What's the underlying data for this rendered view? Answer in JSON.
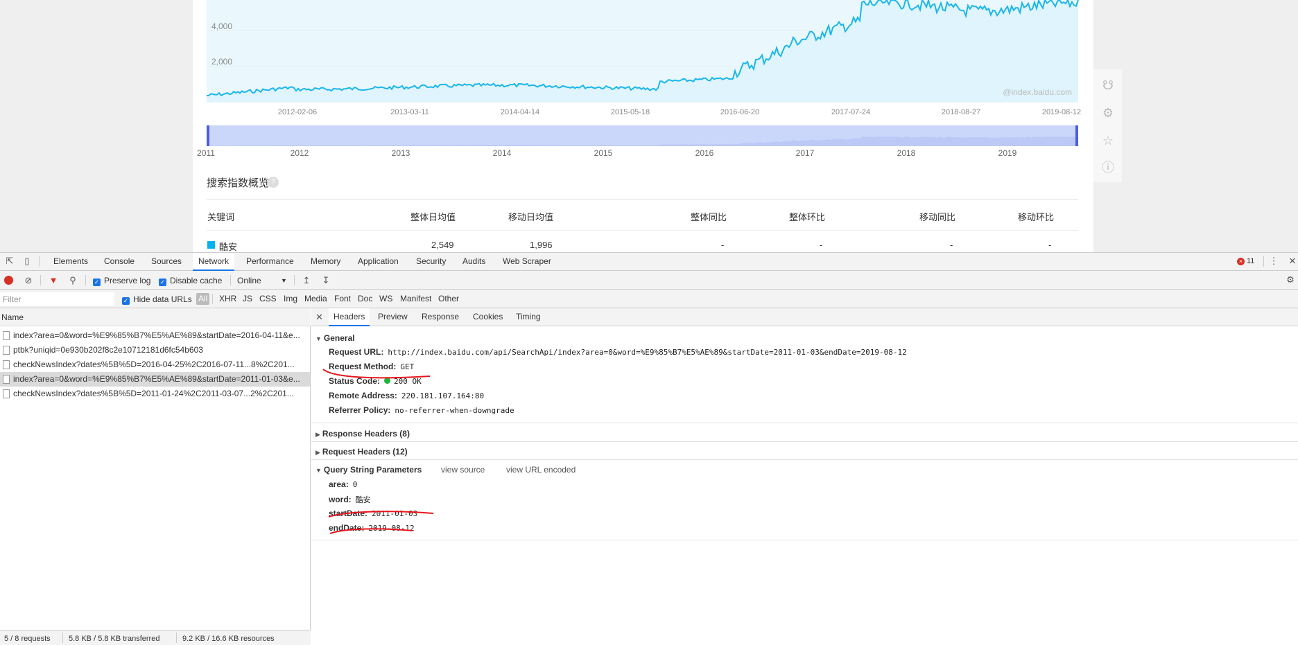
{
  "chart": {
    "y_labels": [
      "4,000",
      "2,000"
    ],
    "x_dates": [
      "2012-02-06",
      "2013-03-11",
      "2014-04-14",
      "2015-05-18",
      "2016-06-20",
      "2017-07-24",
      "2018-08-27",
      "2019-08-12"
    ],
    "years": [
      "2011",
      "2012",
      "2013",
      "2014",
      "2015",
      "2016",
      "2017",
      "2018",
      "2019"
    ],
    "watermark": "@index.baidu.com",
    "line_color": "#1ab6ec",
    "area_color": "#eaf8fe",
    "range_color": "#cbd6fb"
  },
  "overview": {
    "title": "搜索指数概览",
    "help": "?",
    "headers": [
      "关键词",
      "整体日均值",
      "移动日均值",
      "整体同比",
      "整体环比",
      "移动同比",
      "移动环比"
    ],
    "row": [
      "酷安",
      "2,549",
      "1,996",
      "-",
      "-",
      "-",
      "-"
    ]
  },
  "side_icons": [
    "headset-icon",
    "share-icon",
    "star-icon",
    "help-icon"
  ],
  "devtools": {
    "tabs": [
      "Elements",
      "Console",
      "Sources",
      "Network",
      "Performance",
      "Memory",
      "Application",
      "Security",
      "Audits",
      "Web Scraper"
    ],
    "active_tab": "Network",
    "error_count": "11",
    "toolbar": {
      "preserve_log": "Preserve log",
      "disable_cache": "Disable cache",
      "throttle": "Online"
    },
    "filter": {
      "placeholder": "Filter",
      "hide_data_urls": "Hide data URLs",
      "types": [
        "All",
        "XHR",
        "JS",
        "CSS",
        "Img",
        "Media",
        "Font",
        "Doc",
        "WS",
        "Manifest",
        "Other"
      ]
    },
    "name_header": "Name",
    "requests": [
      "index?area=0&word=%E9%85%B7%E5%AE%89&startDate=2016-04-11&e...",
      "ptbk?uniqid=0e930b202f8c2e10712181d6fc54b603",
      "checkNewsIndex?dates%5B%5D=2016-04-25%2C2016-07-11...8%2C201...",
      "index?area=0&word=%E9%85%B7%E5%AE%89&startDate=2011-01-03&e...",
      "checkNewsIndex?dates%5B%5D=2011-01-24%2C2011-03-07...2%2C201..."
    ],
    "status": {
      "requests": "5 / 8 requests",
      "transferred": "5.8 KB / 5.8 KB transferred",
      "resources": "9.2 KB / 16.6 KB resources"
    },
    "detail_tabs": [
      "Headers",
      "Preview",
      "Response",
      "Cookies",
      "Timing"
    ],
    "general": {
      "title": "General",
      "request_url_label": "Request URL:",
      "request_url": "http://index.baidu.com/api/SearchApi/index?area=0&word=%E9%85%B7%E5%AE%89&startDate=2011-01-03&endDate=2019-08-12",
      "method_label": "Request Method:",
      "method": "GET",
      "status_label": "Status Code:",
      "status": "200 OK",
      "remote_label": "Remote Address:",
      "remote": "220.181.107.164:80",
      "referrer_label": "Referrer Policy:",
      "referrer": "no-referrer-when-downgrade"
    },
    "response_headers": "Response Headers (8)",
    "request_headers": "Request Headers (12)",
    "query": {
      "title": "Query String Parameters",
      "view_source": "view source",
      "view_url_encoded": "view URL encoded",
      "params": [
        {
          "k": "area:",
          "v": "0"
        },
        {
          "k": "word:",
          "v": "酷安"
        },
        {
          "k": "startDate:",
          "v": "2011-01-03"
        },
        {
          "k": "endDate:",
          "v": "2019-08-12"
        }
      ]
    }
  }
}
